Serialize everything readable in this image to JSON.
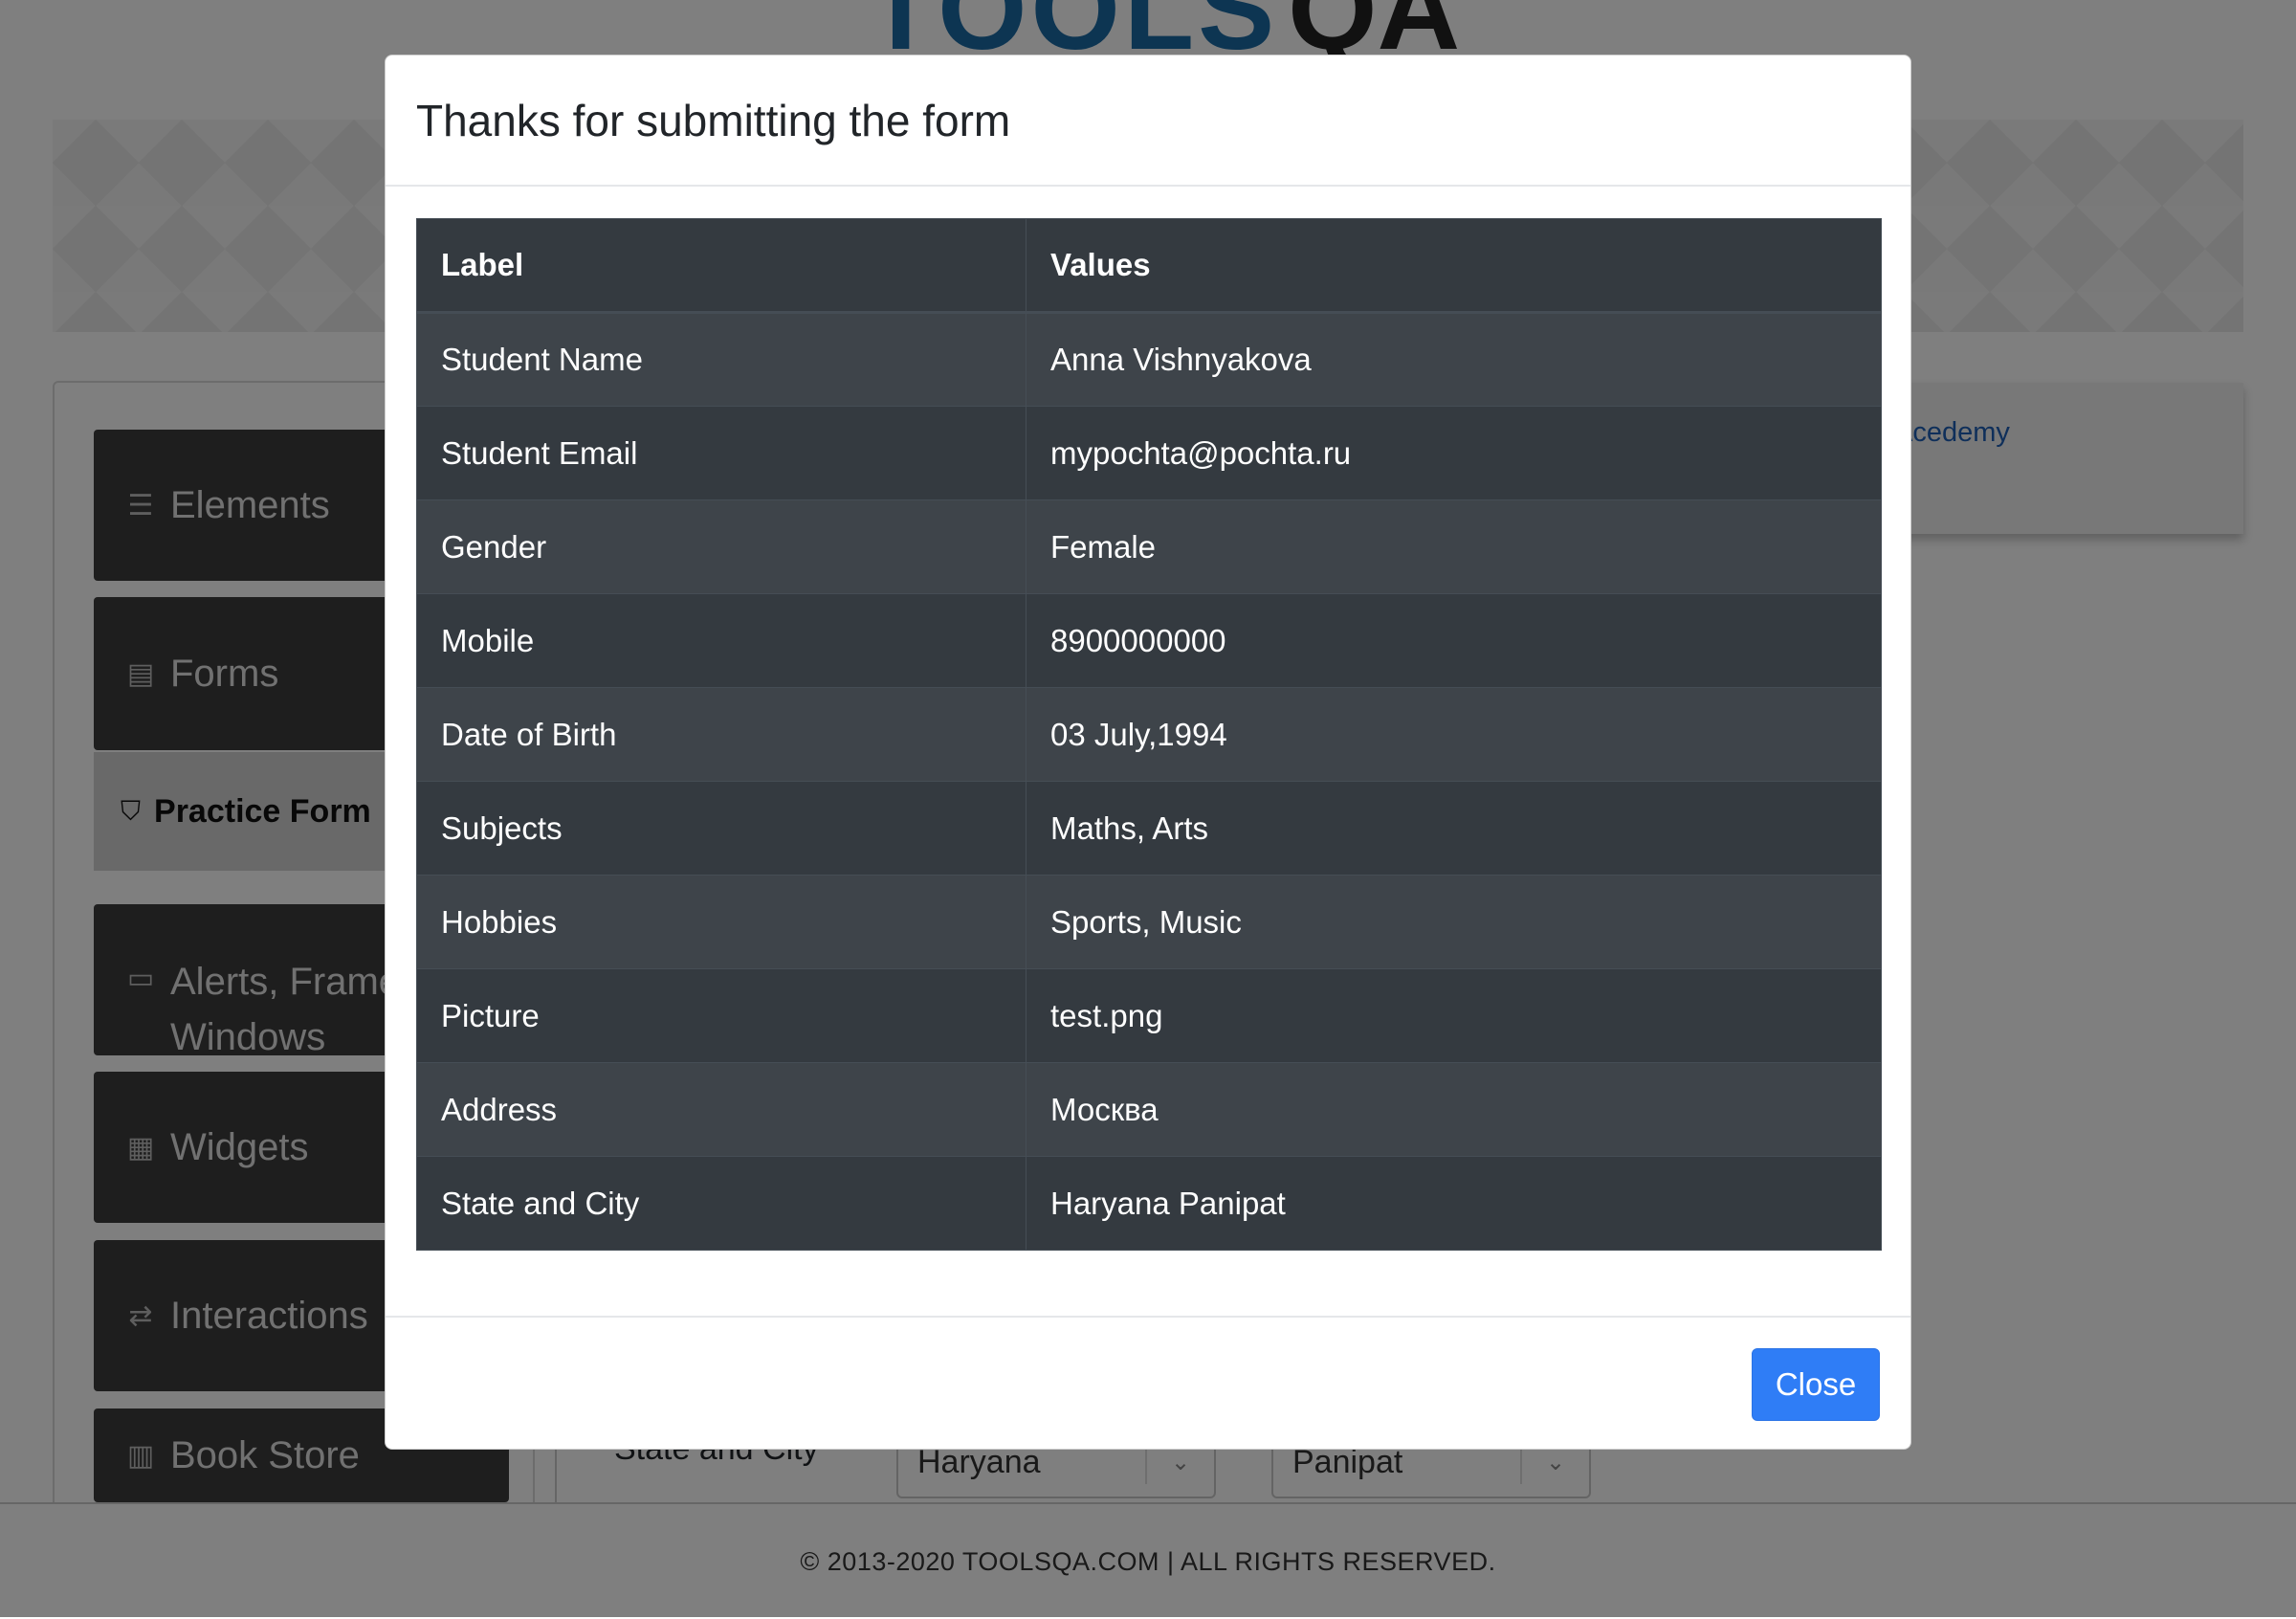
{
  "header": {
    "logo_tools": "TOOLS",
    "logo_qa": "QA"
  },
  "sidebar": {
    "groups": [
      {
        "label": "Elements",
        "icon": "menu-icon"
      },
      {
        "label": "Forms",
        "icon": "document-icon"
      },
      {
        "label": "Alerts, Frame &",
        "label_line2": "Windows",
        "icon": "window-icon"
      },
      {
        "label": "Widgets",
        "icon": "widgets-icon"
      },
      {
        "label": "Interactions",
        "icon": "interactions-icon"
      },
      {
        "label": "Book Store",
        "icon": "books-icon"
      }
    ],
    "active_item": {
      "label": "Practice Form",
      "icon": "html5-icon"
    }
  },
  "right_card": {
    "link_text": "Acedemy"
  },
  "form_behind": {
    "state_city_label": "State and City",
    "state_value": "Haryana",
    "city_value": "Panipat"
  },
  "footer": {
    "text": "© 2013-2020 TOOLSQA.COM | ALL RIGHTS RESERVED."
  },
  "modal": {
    "title": "Thanks for submitting the form",
    "table": {
      "headers": [
        "Label",
        "Values"
      ],
      "rows": [
        [
          "Student Name",
          "Anna Vishnyakova"
        ],
        [
          "Student Email",
          "mypochta@pochta.ru"
        ],
        [
          "Gender",
          "Female"
        ],
        [
          "Mobile",
          "8900000000"
        ],
        [
          "Date of Birth",
          "03 July,1994"
        ],
        [
          "Subjects",
          "Maths, Arts"
        ],
        [
          "Hobbies",
          "Sports, Music"
        ],
        [
          "Picture",
          "test.png"
        ],
        [
          "Address",
          "Москва"
        ],
        [
          "State and City",
          "Haryana Panipat"
        ]
      ]
    },
    "close_label": "Close"
  },
  "colors": {
    "primary_button": "#2f7df6",
    "table_dark": "#343a40",
    "table_striped": "#3e444a",
    "link": "#1e5fb4"
  }
}
